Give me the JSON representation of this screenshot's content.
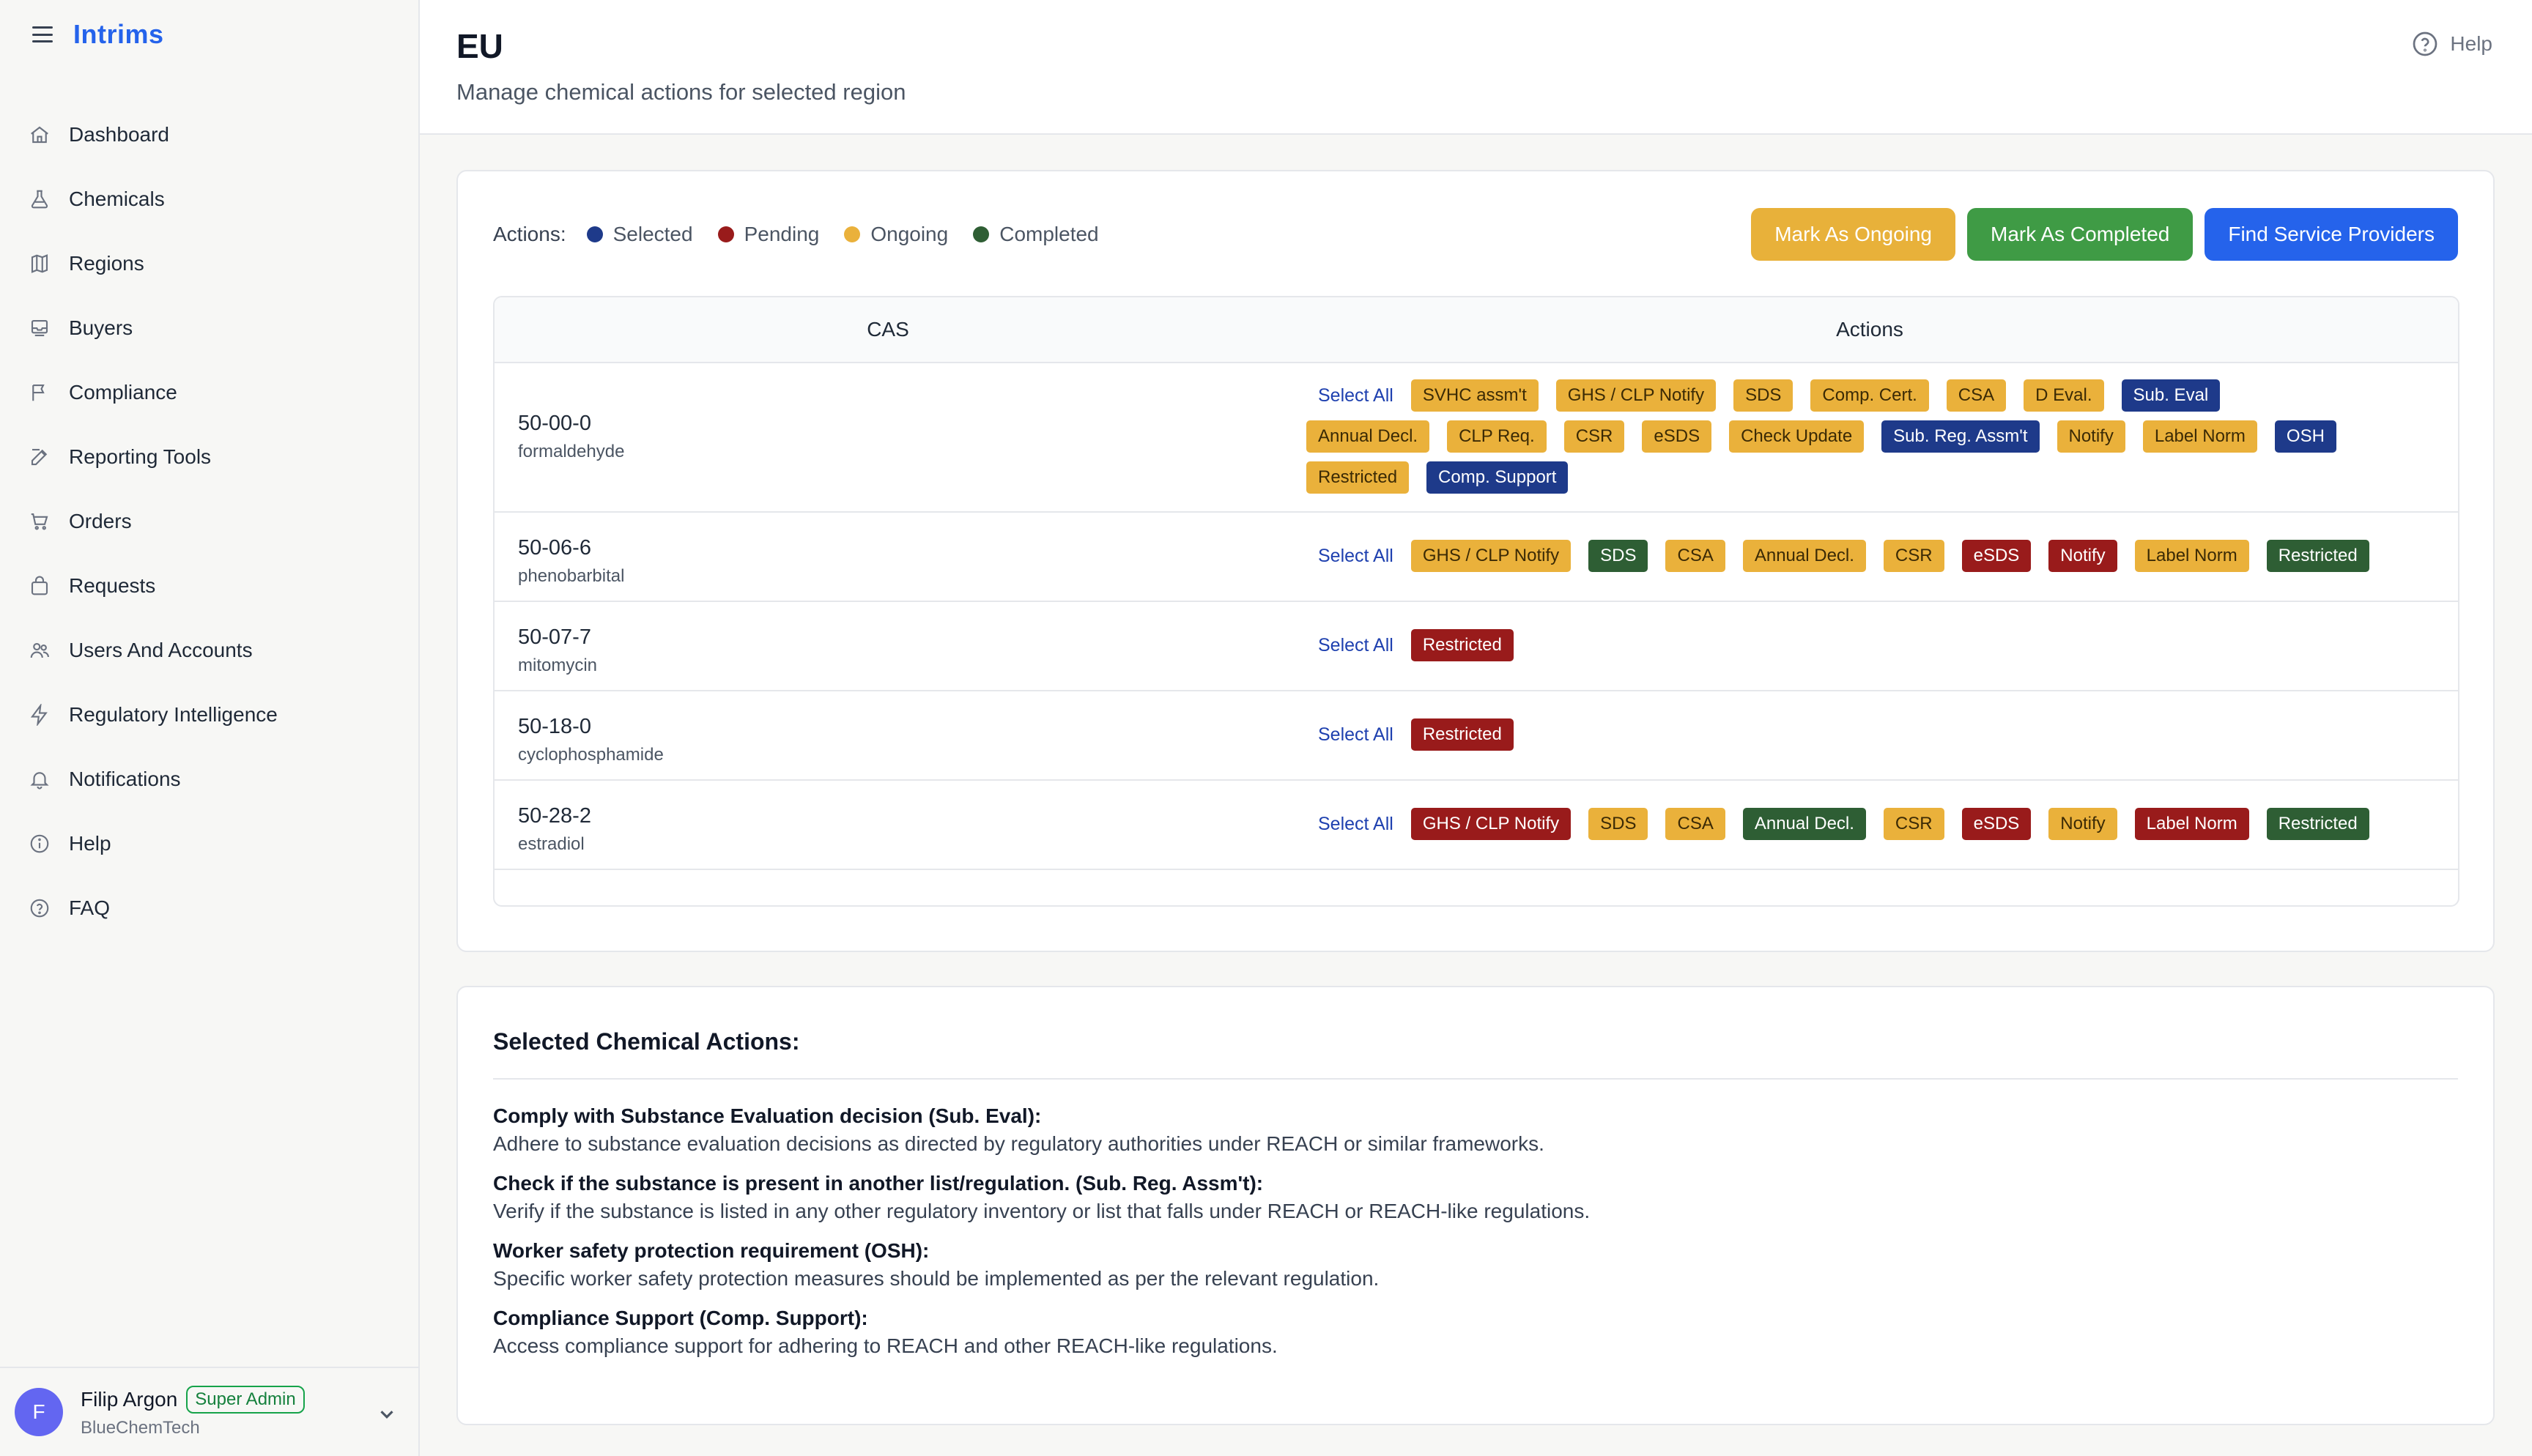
{
  "app": {
    "name": "Intrims"
  },
  "sidebar": {
    "items": [
      {
        "label": "Dashboard",
        "icon": "home-icon"
      },
      {
        "label": "Chemicals",
        "icon": "flask-icon"
      },
      {
        "label": "Regions",
        "icon": "map-icon"
      },
      {
        "label": "Buyers",
        "icon": "inbox-icon"
      },
      {
        "label": "Compliance",
        "icon": "flag-icon"
      },
      {
        "label": "Reporting Tools",
        "icon": "edit-icon"
      },
      {
        "label": "Orders",
        "icon": "cart-icon"
      },
      {
        "label": "Requests",
        "icon": "bag-icon"
      },
      {
        "label": "Users And Accounts",
        "icon": "users-icon"
      },
      {
        "label": "Regulatory Intelligence",
        "icon": "bolt-icon"
      },
      {
        "label": "Notifications",
        "icon": "bell-icon"
      },
      {
        "label": "Help",
        "icon": "info-icon"
      },
      {
        "label": "FAQ",
        "icon": "question-icon"
      }
    ]
  },
  "user": {
    "initial": "F",
    "name": "Filip Argon",
    "role": "Super Admin",
    "org": "BlueChemTech"
  },
  "header": {
    "title": "EU",
    "subtitle": "Manage chemical actions for selected region",
    "help_label": "Help"
  },
  "legend": {
    "label": "Actions:",
    "items": [
      {
        "label": "Selected",
        "color": "#1e3a8a"
      },
      {
        "label": "Pending",
        "color": "#991b1b"
      },
      {
        "label": "Ongoing",
        "color": "#eab13b"
      },
      {
        "label": "Completed",
        "color": "#2e5e34"
      }
    ]
  },
  "buttons": {
    "mark_ongoing": "Mark As Ongoing",
    "mark_completed": "Mark As Completed",
    "find_providers": "Find Service Providers"
  },
  "table": {
    "headers": {
      "cas": "CAS",
      "actions": "Actions"
    },
    "select_all_label": "Select All",
    "rows": [
      {
        "cas": "50-00-0",
        "name": "formaldehyde",
        "tags": [
          {
            "label": "SVHC assm't",
            "status": "ongoing"
          },
          {
            "label": "GHS / CLP Notify",
            "status": "ongoing"
          },
          {
            "label": "SDS",
            "status": "ongoing"
          },
          {
            "label": "Comp. Cert.",
            "status": "ongoing"
          },
          {
            "label": "CSA",
            "status": "ongoing"
          },
          {
            "label": "D Eval.",
            "status": "ongoing"
          },
          {
            "label": "Sub. Eval",
            "status": "selected"
          },
          {
            "label": "Annual Decl.",
            "status": "ongoing"
          },
          {
            "label": "CLP Req.",
            "status": "ongoing"
          },
          {
            "label": "CSR",
            "status": "ongoing"
          },
          {
            "label": "eSDS",
            "status": "ongoing"
          },
          {
            "label": "Check Update",
            "status": "ongoing"
          },
          {
            "label": "Sub. Reg. Assm't",
            "status": "selected"
          },
          {
            "label": "Notify",
            "status": "ongoing"
          },
          {
            "label": "Label Norm",
            "status": "ongoing"
          },
          {
            "label": "OSH",
            "status": "selected"
          },
          {
            "label": "Restricted",
            "status": "ongoing"
          },
          {
            "label": "Comp. Support",
            "status": "selected"
          }
        ]
      },
      {
        "cas": "50-06-6",
        "name": "phenobarbital",
        "tags": [
          {
            "label": "GHS / CLP Notify",
            "status": "ongoing"
          },
          {
            "label": "SDS",
            "status": "completed"
          },
          {
            "label": "CSA",
            "status": "ongoing"
          },
          {
            "label": "Annual Decl.",
            "status": "ongoing"
          },
          {
            "label": "CSR",
            "status": "ongoing"
          },
          {
            "label": "eSDS",
            "status": "pending"
          },
          {
            "label": "Notify",
            "status": "pending"
          },
          {
            "label": "Label Norm",
            "status": "ongoing"
          },
          {
            "label": "Restricted",
            "status": "completed"
          }
        ]
      },
      {
        "cas": "50-07-7",
        "name": "mitomycin",
        "tags": [
          {
            "label": "Restricted",
            "status": "pending"
          }
        ]
      },
      {
        "cas": "50-18-0",
        "name": "cyclophosphamide",
        "tags": [
          {
            "label": "Restricted",
            "status": "pending"
          }
        ]
      },
      {
        "cas": "50-28-2",
        "name": "estradiol",
        "tags": [
          {
            "label": "GHS / CLP Notify",
            "status": "pending"
          },
          {
            "label": "SDS",
            "status": "ongoing"
          },
          {
            "label": "CSA",
            "status": "ongoing"
          },
          {
            "label": "Annual Decl.",
            "status": "completed"
          },
          {
            "label": "CSR",
            "status": "ongoing"
          },
          {
            "label": "eSDS",
            "status": "pending"
          },
          {
            "label": "Notify",
            "status": "ongoing"
          },
          {
            "label": "Label Norm",
            "status": "pending"
          },
          {
            "label": "Restricted",
            "status": "completed"
          }
        ]
      }
    ]
  },
  "selected_actions": {
    "title": "Selected Chemical Actions:",
    "items": [
      {
        "heading": "Comply with Substance Evaluation decision (Sub. Eval):",
        "description": "Adhere to substance evaluation decisions as directed by regulatory authorities under REACH or similar frameworks."
      },
      {
        "heading": "Check if the substance is present in another list/regulation. (Sub. Reg. Assm't):",
        "description": "Verify if the substance is listed in any other regulatory inventory or list that falls under REACH or REACH-like regulations."
      },
      {
        "heading": "Worker safety protection requirement (OSH):",
        "description": "Specific worker safety protection measures should be implemented as per the relevant regulation."
      },
      {
        "heading": "Compliance Support (Comp. Support):",
        "description": "Access compliance support for adhering to REACH and other REACH-like regulations."
      }
    ]
  }
}
